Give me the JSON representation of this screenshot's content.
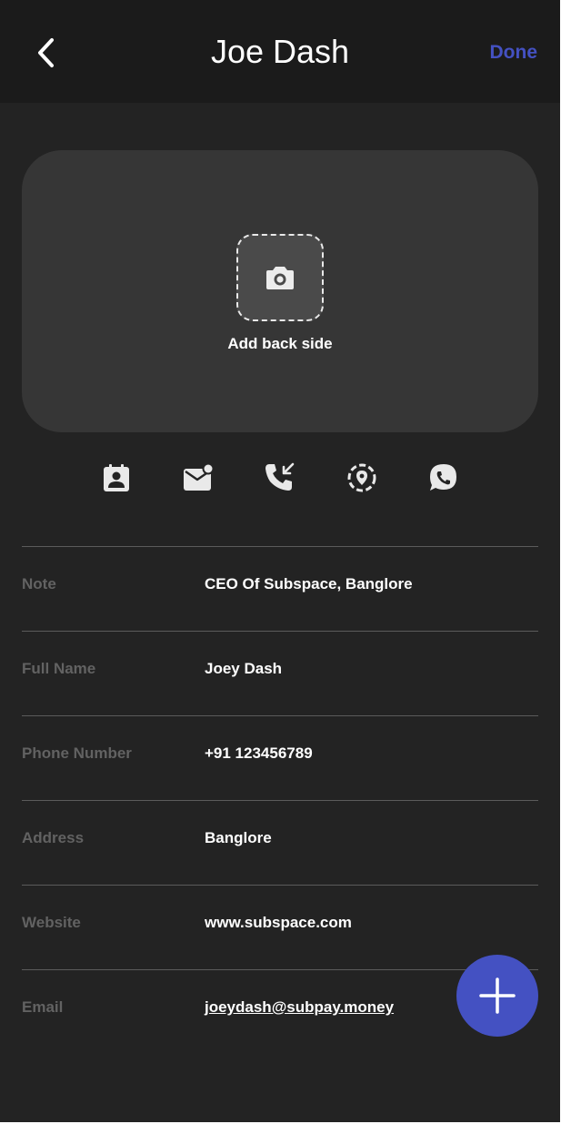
{
  "header": {
    "title": "Joe Dash",
    "back_icon": "chevron-left-icon",
    "done_label": "Done"
  },
  "card": {
    "camera_icon": "camera-icon",
    "add_back_label": "Add back side"
  },
  "actions": [
    {
      "icon": "contact-card-icon"
    },
    {
      "icon": "email-icon"
    },
    {
      "icon": "phone-call-icon"
    },
    {
      "icon": "location-icon"
    },
    {
      "icon": "whatsapp-icon"
    }
  ],
  "fields": [
    {
      "label": "Note",
      "value": "CEO Of Subspace, Banglore"
    },
    {
      "label": "Full Name",
      "value": "Joey Dash"
    },
    {
      "label": "Phone Number",
      "value": "+91 123456789"
    },
    {
      "label": "Address",
      "value": "Banglore"
    },
    {
      "label": "Website",
      "value": "www.subspace.com"
    },
    {
      "label": "Email",
      "value": "joeydash@subpay.money"
    }
  ],
  "fab": {
    "icon": "plus-icon"
  },
  "colors": {
    "background": "#232323",
    "header": "#1b1b1b",
    "card": "#363636",
    "accent": "#4451c2",
    "label": "#626262",
    "icon": "#e9e9e9"
  }
}
